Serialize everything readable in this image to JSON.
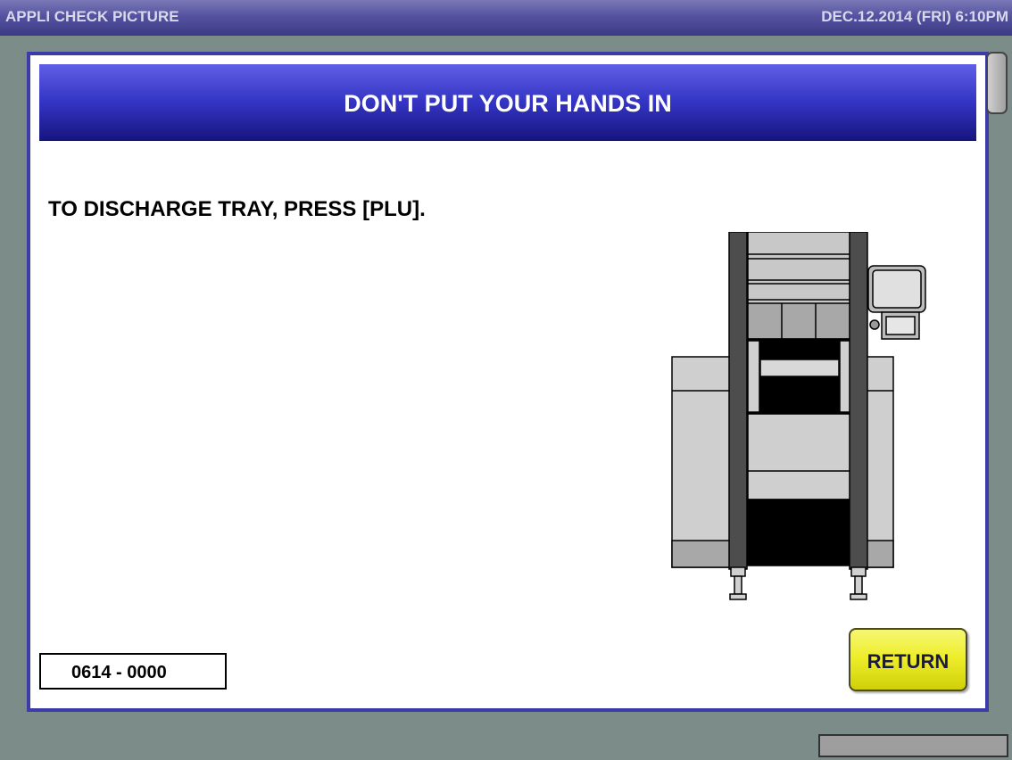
{
  "titlebar": {
    "app_title": "APPLI CHECK PICTURE",
    "datetime": "DEC.12.2014 (FRI)   6:10PM"
  },
  "dialog": {
    "header": "DON'T PUT YOUR HANDS IN",
    "instruction": "TO DISCHARGE TRAY, PRESS [PLU].",
    "code": "0614 - 0000",
    "return_label": "RETURN"
  },
  "illustration": {
    "icon": "packaging-machine-icon"
  },
  "colors": {
    "titlebar": "#5553a0",
    "dialog_header": "#3434c4",
    "dialog_border": "#3b3ca8",
    "return_button": "#eeee2c",
    "background": "#7c8c88"
  }
}
